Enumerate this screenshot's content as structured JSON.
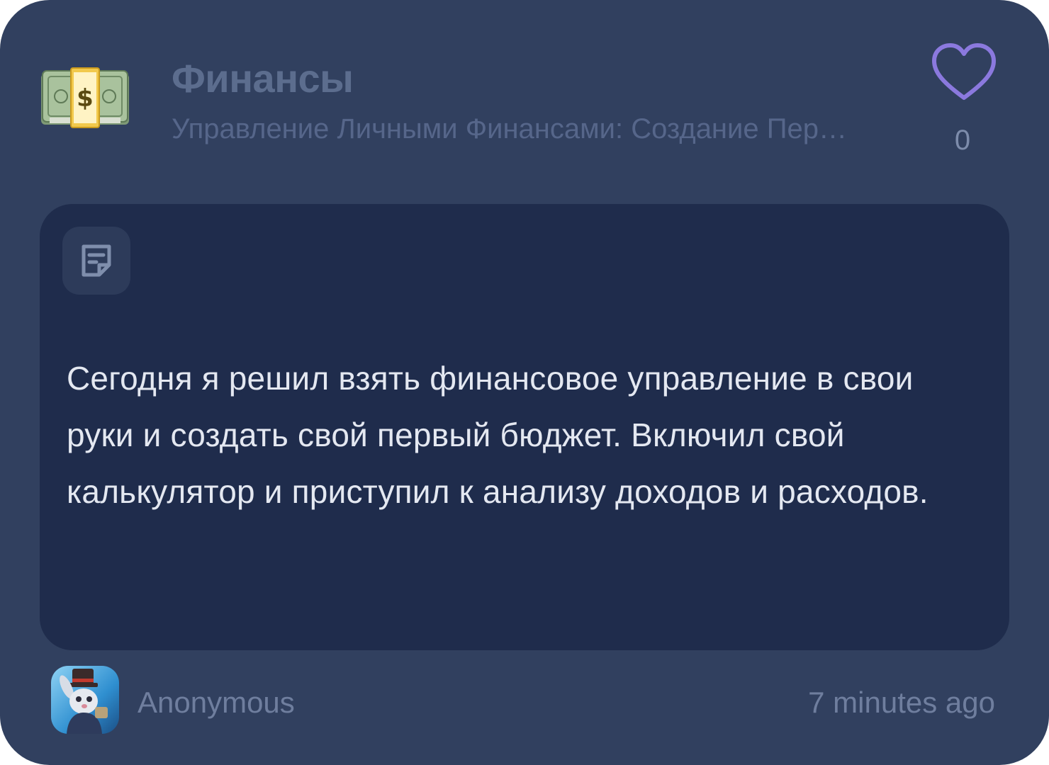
{
  "post": {
    "category_icon": "money-bag-banknote-emoji",
    "title": "Финансы",
    "subtitle": "Управление Личными Финансами: Создание Первого Бюджета",
    "like_icon": "heart-outline-icon",
    "like_count": "0",
    "note_icon": "note-icon",
    "body": "Сегодня я решил взять финансовое управление в свои руки и создать свой первый бюджет. Включил свой калькулятор и приступил к анализу доходов и расходов.",
    "author": "Anonymous",
    "author_avatar": "rabbit-avatar",
    "timestamp": "7 minutes ago"
  },
  "colors": {
    "card_background": "#31405f",
    "content_background": "#1f2c4c",
    "like_accent": "#8b79de",
    "body_text": "#e4e8f1",
    "muted_text": "#6f7e9e"
  }
}
